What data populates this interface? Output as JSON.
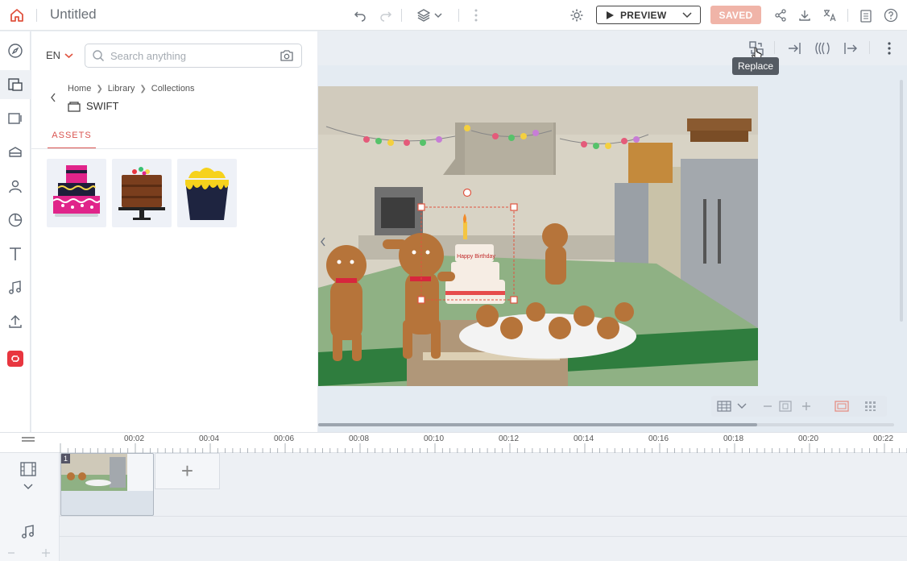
{
  "topbar": {
    "doc_title": "Untitled",
    "preview_label": "PREVIEW",
    "saved_label": "SAVED"
  },
  "panel": {
    "language": "EN",
    "search_placeholder": "Search anything",
    "breadcrumb": [
      "Home",
      "Library",
      "Collections"
    ],
    "folder_name": "SWIFT",
    "tab_assets": "ASSETS",
    "assets": [
      "cake-pink-icon",
      "cake-chocolate-icon",
      "cake-yellow-drip-icon"
    ]
  },
  "stage": {
    "tooltip": "Replace",
    "cake_topper_text": "Happy Birthday"
  },
  "timeline": {
    "ticks": [
      "00:02",
      "00:04",
      "00:06",
      "00:08",
      "00:10",
      "00:12",
      "00:14",
      "00:16",
      "00:18",
      "00:20",
      "00:22"
    ],
    "clip_number": "1",
    "add_scene": "+"
  },
  "colors": {
    "accent": "#d9534f",
    "saved_bg": "#f0b4a8",
    "brand": "#e8363f"
  }
}
